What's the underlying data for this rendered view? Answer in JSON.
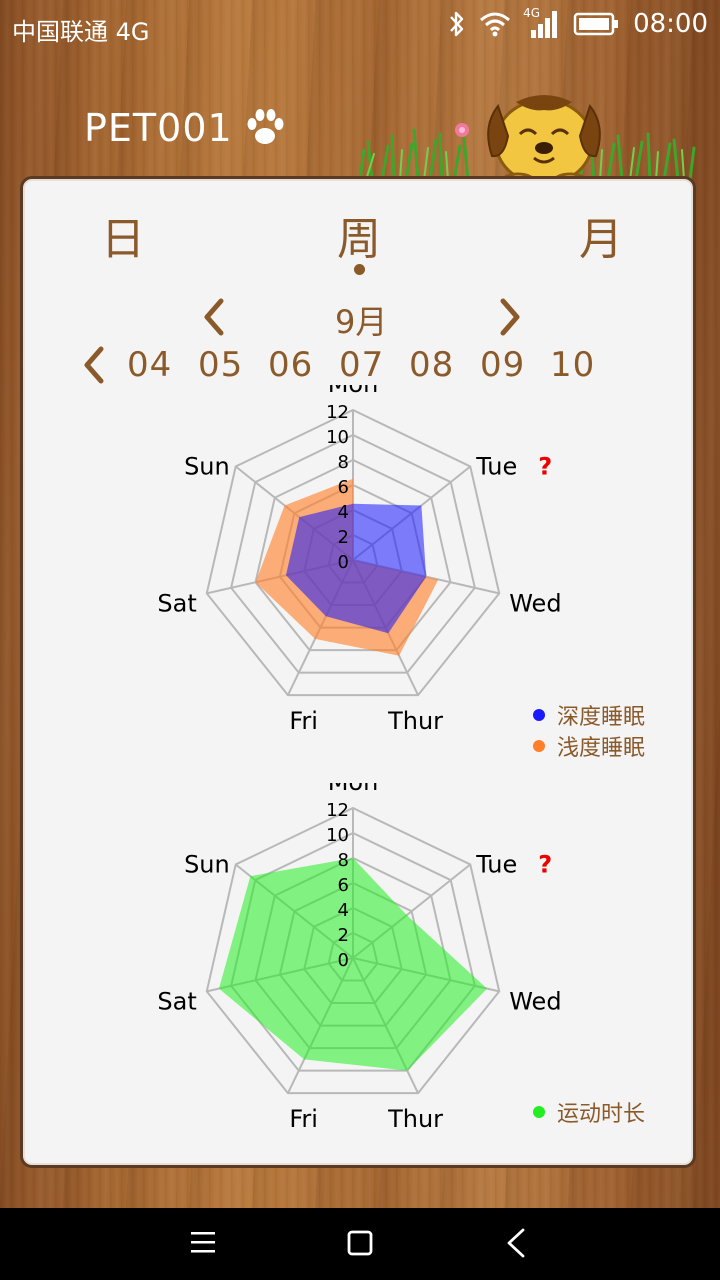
{
  "status": {
    "carrier": "中国联通 4G",
    "time": "08:00",
    "network_badge": "4G"
  },
  "header": {
    "pet_name": "PET001"
  },
  "tabs": [
    {
      "label": "日"
    },
    {
      "label": "周"
    },
    {
      "label": "月"
    }
  ],
  "month_nav": {
    "label": "9月"
  },
  "dates": [
    "04",
    "05",
    "06",
    "07",
    "08",
    "09",
    "10"
  ],
  "colors": {
    "brown": "#8b5a2b",
    "deep_sleep": "#1a1aff",
    "light_sleep": "#ff7f2a",
    "exercise": "#22ee22",
    "question": "#ee0000"
  },
  "chart_data": [
    {
      "type": "radar",
      "categories": [
        "Mon",
        "Tue",
        "Wed",
        "Thur",
        "Fri",
        "Sat",
        "Sun"
      ],
      "axis_ticks": [
        "0",
        "2",
        "4",
        "6",
        "8",
        "10",
        "12"
      ],
      "ylim": [
        0,
        12
      ],
      "flagged_category": "Tue",
      "flag_label": "?",
      "series": [
        {
          "name": "浅度睡眠",
          "values": [
            6.5,
            0,
            7,
            8.5,
            7,
            8,
            7
          ],
          "color": "#ff7f2a"
        },
        {
          "name": "深度睡眠",
          "values": [
            4.5,
            7,
            6,
            6.5,
            5,
            5.5,
            5.5
          ],
          "color": "#1a1aff"
        }
      ]
    },
    {
      "type": "radar",
      "categories": [
        "Mon",
        "Tue",
        "Wed",
        "Thur",
        "Fri",
        "Sat",
        "Sun"
      ],
      "axis_ticks": [
        "0",
        "2",
        "4",
        "6",
        "8",
        "10",
        "12"
      ],
      "ylim": [
        0,
        12
      ],
      "flagged_category": "Tue",
      "flag_label": "?",
      "series": [
        {
          "name": "运动时长",
          "values": [
            8,
            5.5,
            11,
            10,
            9,
            11,
            10.5
          ],
          "color": "#22ee22"
        }
      ]
    }
  ]
}
